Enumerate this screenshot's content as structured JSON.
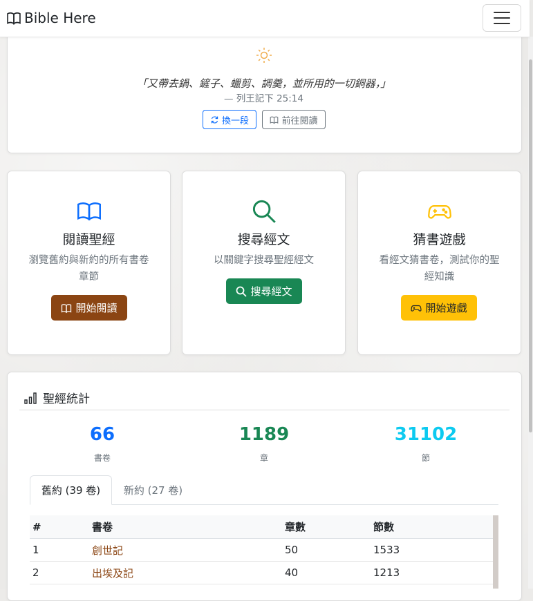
{
  "navbar": {
    "brand": "Bible Here",
    "menu_toggle_label": ""
  },
  "verse": {
    "text": "「又帶去鍋、鏟子、蠟剪、調羹，並所用的一切銅器，」",
    "reference": "— 列王記下 25:14",
    "refresh_label": "換一段",
    "goto_label": "前往閱讀"
  },
  "features": [
    {
      "title": "閱讀聖經",
      "desc": "瀏覽舊約與新約的所有書卷章節",
      "button": "開始閱讀",
      "icon": "book-open-icon",
      "color": "#0d6efd"
    },
    {
      "title": "搜尋經文",
      "desc": "以關鍵字搜尋聖經經文",
      "button": "搜尋經文",
      "icon": "search-icon",
      "color": "#198754"
    },
    {
      "title": "猜書遊戲",
      "desc": "看經文猜書卷，測試你的聖經知識",
      "button": "開始遊戲",
      "icon": "gamepad-icon",
      "color": "#ffc107"
    }
  ],
  "stats": {
    "title": "聖經統計",
    "items": [
      {
        "value": "66",
        "label": "書卷",
        "color": "#0d6efd"
      },
      {
        "value": "1189",
        "label": "章",
        "color": "#198754"
      },
      {
        "value": "31102",
        "label": "節",
        "color": "#0dcaf0"
      }
    ]
  },
  "tabs": {
    "ot": "舊約 (39 卷)",
    "nt": "新約 (27 卷)"
  },
  "table": {
    "headers": [
      "#",
      "書卷",
      "章數",
      "節數"
    ],
    "rows": [
      [
        "1",
        "創世記",
        "50",
        "1533"
      ],
      [
        "2",
        "出埃及記",
        "40",
        "1213"
      ]
    ]
  }
}
